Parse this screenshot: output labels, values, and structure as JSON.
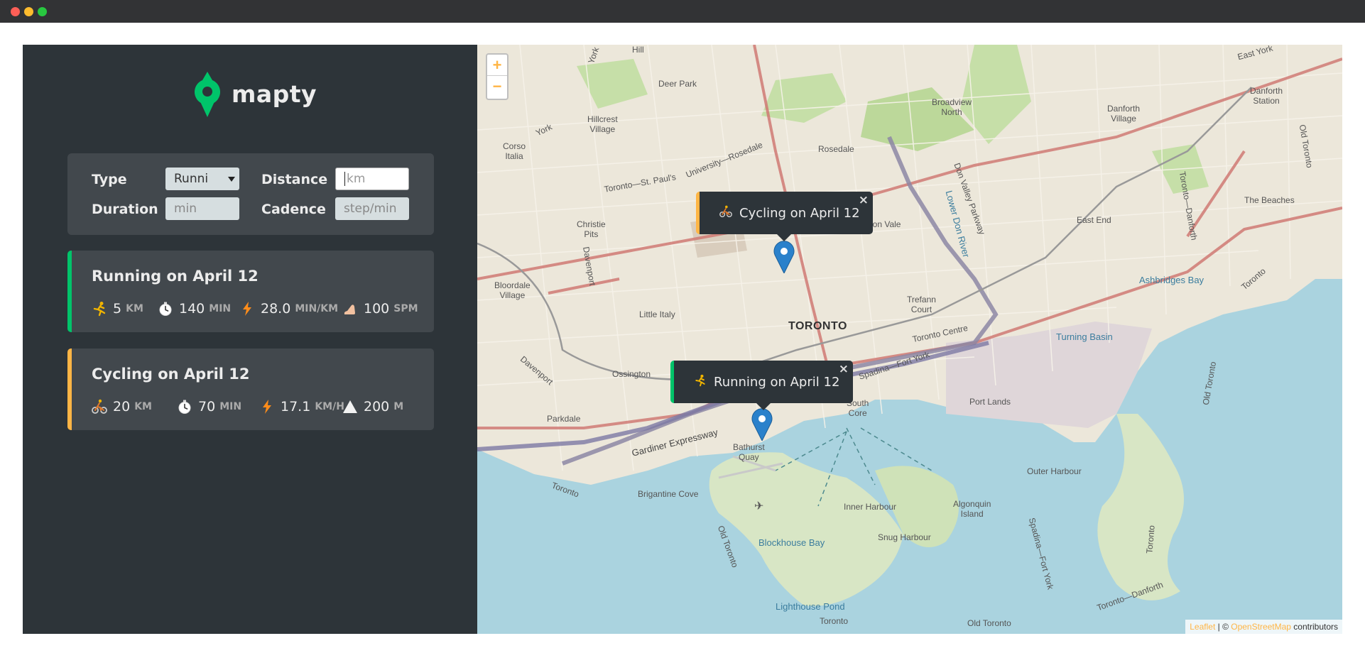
{
  "window": {
    "controls": [
      "close",
      "minimize",
      "maximize"
    ]
  },
  "sidebar": {
    "logo_text": "mapty",
    "form": {
      "type_label": "Type",
      "type_value": "Runni",
      "distance_label": "Distance",
      "distance_placeholder": "km",
      "duration_label": "Duration",
      "duration_placeholder": "min",
      "cadence_label": "Cadence",
      "cadence_placeholder": "step/min"
    },
    "workouts": [
      {
        "title": "Running on April 12",
        "type": "running",
        "accent": "#00c46a",
        "stats": [
          {
            "icon": "runner-icon",
            "value": "5",
            "unit": "KM"
          },
          {
            "icon": "stopwatch-icon",
            "value": "140",
            "unit": "MIN"
          },
          {
            "icon": "lightning-icon",
            "value": "28.0",
            "unit": "MIN/KM"
          },
          {
            "icon": "foot-icon",
            "value": "100",
            "unit": "SPM"
          }
        ]
      },
      {
        "title": "Cycling on April 12",
        "type": "cycling",
        "accent": "#ffb545",
        "stats": [
          {
            "icon": "cyclist-icon",
            "value": "20",
            "unit": "KM"
          },
          {
            "icon": "stopwatch-icon",
            "value": "70",
            "unit": "MIN"
          },
          {
            "icon": "lightning-icon",
            "value": "17.1",
            "unit": "KM/H"
          },
          {
            "icon": "mountain-icon",
            "value": "200",
            "unit": "M"
          }
        ]
      }
    ]
  },
  "map": {
    "zoom_in": "+",
    "zoom_out": "−",
    "popups": {
      "cycling": {
        "icon": "cyclist-icon",
        "text": "Cycling on April 12",
        "close": "×"
      },
      "running": {
        "icon": "runner-icon",
        "text": "Running on April 12",
        "close": "×"
      }
    },
    "labels": {
      "toronto": "TORONTO",
      "hill": "Hill",
      "york": "York",
      "deer_park": "Deer Park",
      "hillcrest": "Hillcrest\nVillage",
      "corso": "Corso\nItalia",
      "rosedale": "Rosedale",
      "broadview": "Broadview\nNorth",
      "danforth_village": "Danforth\nVillage",
      "east_york": "East York",
      "danforth_station": "Danforth\nStation",
      "christie": "Christie\nPits",
      "davenport": "Davenport",
      "don_vale": "Don Vale",
      "east_end": "East End",
      "the_beaches": "The Beaches",
      "bloordale": "Bloordale\nVillage",
      "little_italy": "Little Italy",
      "trefann": "Trefann\nCourt",
      "toronto_centre": "Toronto Centre",
      "ashbridges": "Ashbridges Bay",
      "turning_basin": "Turning Basin",
      "ossington": "Ossington",
      "parkdale": "Parkdale",
      "port_lands": "Port Lands",
      "bathurst_quay": "Bathurst\nQuay",
      "south_core": "South\nCore",
      "gardiner": "Gardiner Expressway",
      "outer_harbour": "Outer Harbour",
      "brigantine": "Brigantine Cove",
      "inner_harbour": "Inner Harbour",
      "algonquin": "Algonquin\nIsland",
      "blockhouse": "Blockhouse Bay",
      "snug_harbour": "Snug Harbour",
      "lighthouse_pond": "Lighthouse Pond",
      "toronto_bottom": "Toronto",
      "old_toronto": "Old Toronto",
      "toronto_danforth": "Toronto—Danforth",
      "spadina_fort_york": "Spadina—Fort York",
      "toronto_st_pauls": "Toronto—St. Paul's",
      "university_rosedale": "University—Rosedale",
      "don_valley_parkway": "Don Valley Parkway",
      "lower_don_river": "Lower Don River",
      "toronto_coast": "Toronto"
    },
    "attribution": {
      "leaflet": "Leaflet",
      "sep": " | © ",
      "osm": "OpenStreetMap",
      "tail": " contributors"
    }
  }
}
